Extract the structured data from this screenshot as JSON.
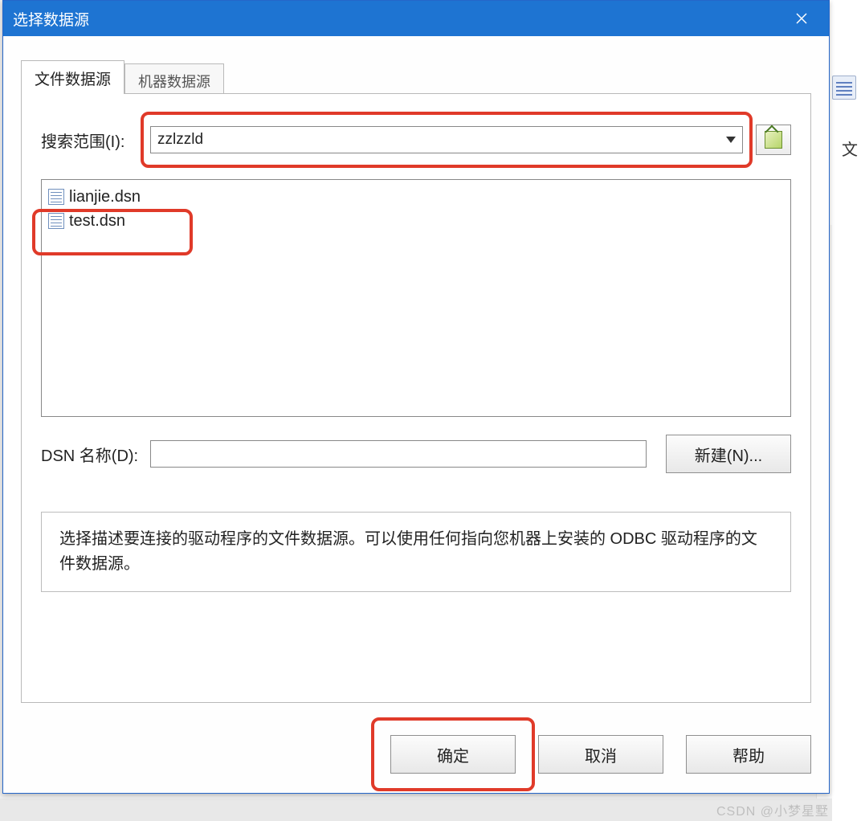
{
  "window": {
    "title": "选择数据源",
    "close_label": "关闭"
  },
  "tabs": [
    {
      "label": "文件数据源",
      "active": true
    },
    {
      "label": "机器数据源",
      "active": false
    }
  ],
  "search": {
    "label": "搜索范围(I):",
    "value": "zzlzzld"
  },
  "files": [
    {
      "name": "lianjie.dsn"
    },
    {
      "name": "test.dsn"
    }
  ],
  "dsn": {
    "label": "DSN 名称(D):",
    "value": ""
  },
  "buttons": {
    "new": "新建(N)...",
    "ok": "确定",
    "cancel": "取消",
    "help": "帮助"
  },
  "help_text": "选择描述要连接的驱动程序的文件数据源。可以使用任何指向您机器上安装的 ODBC 驱动程序的文件数据源。",
  "bg": {
    "text_fragment": "文",
    "watermark": "CSDN @小梦星墅"
  }
}
